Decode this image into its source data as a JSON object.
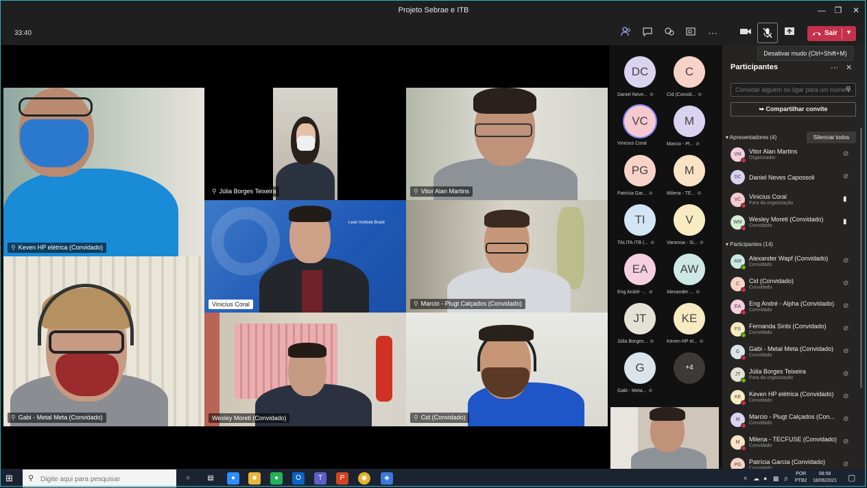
{
  "window": {
    "title": "Projeto Sebrae e ITB"
  },
  "toolbar": {
    "timer": "33:40",
    "leave_label": "Sair",
    "mute_tooltip": "Desativar mudo (Ctrl+Shift+M)"
  },
  "stage": {
    "tiles": [
      {
        "name": "Keven HP elétrica (Convidado)"
      },
      {
        "name": "Júlia Borges Teixeira"
      },
      {
        "name": "Vitor Alan Martins"
      },
      {
        "name": "Vinicius Coral",
        "logo": "Lean Institute Brasil"
      },
      {
        "name": "Marcio - Plugt Calçados (Convidado)"
      },
      {
        "name": "Gabi - Metal Meta (Convidado)"
      },
      {
        "name": "Wesley Moreti (Convidado)"
      },
      {
        "name": "Cid (Convidado)"
      }
    ]
  },
  "roster": [
    {
      "initials": "DC",
      "label": "Daniel Neve...",
      "color": "#d9d3f0"
    },
    {
      "initials": "C",
      "label": "Cid (Convid...",
      "color": "#f7d2c8"
    },
    {
      "initials": "VC",
      "label": "Vinicius Coral",
      "color": "#f5c9cf"
    },
    {
      "initials": "M",
      "label": "Marcio - Pl...",
      "color": "#d9d3f0"
    },
    {
      "initials": "PG",
      "label": "Patrícia Gar...",
      "color": "#f7d2c8"
    },
    {
      "initials": "M",
      "label": "Milena - TE...",
      "color": "#f9e3c4"
    },
    {
      "initials": "TI",
      "label": "TALITA ITB (...",
      "color": "#d3e4f5"
    },
    {
      "initials": "V",
      "label": "Vanessa - Si...",
      "color": "#f7ebc1"
    },
    {
      "initials": "EA",
      "label": "Eng André -...",
      "color": "#f5cfe0"
    },
    {
      "initials": "AW",
      "label": "Alexander ...",
      "color": "#cde8e4"
    },
    {
      "initials": "JT",
      "label": "Júlia Borges...",
      "color": "#e2e2d6"
    },
    {
      "initials": "KE",
      "label": "Keven HP el...",
      "color": "#f7ebc1"
    },
    {
      "initials": "G",
      "label": "Gabi - Meta...",
      "color": "#dbe4ea"
    },
    {
      "initials": "+4",
      "label": "",
      "color": "#3b3a39"
    }
  ],
  "panel": {
    "title": "Participantes",
    "invite_placeholder": "Convidar alguém ou ligar para um número",
    "share_label": "Compartilhar convite",
    "presenters_header": "Apresentadores (4)",
    "mute_all": "Silenciar todos",
    "presenters": [
      {
        "initials": "VM",
        "name": "Vitor Alan Martins",
        "sub": "Organizador",
        "color": "#f5cfe0",
        "dot": "#c4314b",
        "mic": "muted"
      },
      {
        "initials": "DC",
        "name": "Daniel Neves Capossoli",
        "sub": "",
        "color": "#d9d3f0",
        "dot": "",
        "mic": "muted"
      },
      {
        "initials": "VC",
        "name": "Vinicius Coral",
        "sub": "Fora da organização",
        "color": "#f5c9cf",
        "dot": "#c4314b",
        "mic": "on"
      },
      {
        "initials": "WM",
        "name": "Wesley Moreti (Convidado)",
        "sub": "Convidado",
        "color": "#d6ecd2",
        "dot": "#c4314b",
        "mic": "on"
      }
    ],
    "participants_header": "Participantes (14)",
    "participants": [
      {
        "initials": "AW",
        "name": "Alexander Wapf (Convidado)",
        "sub": "Convidado",
        "color": "#cde8e4",
        "dot": "#6bb700"
      },
      {
        "initials": "C",
        "name": "Cid (Convidado)",
        "sub": "Convidado",
        "color": "#f7d2c8",
        "dot": "#c4314b"
      },
      {
        "initials": "EA",
        "name": "Eng André - Alpha (Convidado)",
        "sub": "Convidado",
        "color": "#f5cfe0",
        "dot": "#c4314b"
      },
      {
        "initials": "FS",
        "name": "Fernanda Sinbi (Convidado)",
        "sub": "Convidado",
        "color": "#f7ebc1",
        "dot": "#6bb700"
      },
      {
        "initials": "G",
        "name": "Gabi - Metal Meta (Convidado)",
        "sub": "Convidado",
        "color": "#dbe4ea",
        "dot": "#c4314b"
      },
      {
        "initials": "JT",
        "name": "Júlia Borges Teixeira",
        "sub": "Fora da organização",
        "color": "#e2e2d6",
        "dot": "#6bb700"
      },
      {
        "initials": "KE",
        "name": "Keven HP elétrica (Convidado)",
        "sub": "Convidado",
        "color": "#f7ebc1",
        "dot": "#c4314b"
      },
      {
        "initials": "M",
        "name": "Marcio - Plugt Calçados (Con...",
        "sub": "Convidado",
        "color": "#d9d3f0",
        "dot": "#c4314b"
      },
      {
        "initials": "M",
        "name": "Milena - TECFUSE (Convidado)",
        "sub": "Convidado",
        "color": "#f9e3c4",
        "dot": "#c4314b"
      },
      {
        "initials": "PG",
        "name": "Patrícia Garcia (Convidado)",
        "sub": "Convidado",
        "color": "#f7d2c8",
        "dot": "#c4314b"
      }
    ]
  },
  "taskbar": {
    "search_placeholder": "Digite aqui para pesquisar",
    "lang": "POR",
    "lang2": "PTB2",
    "time": "08:58",
    "date": "18/06/2021"
  }
}
